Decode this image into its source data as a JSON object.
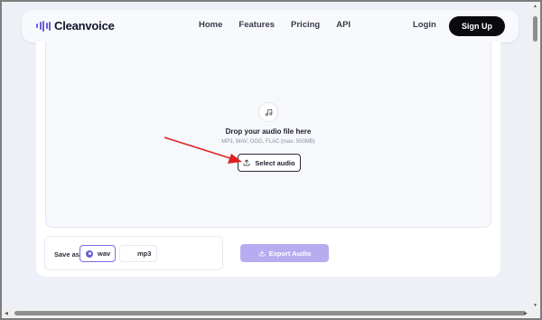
{
  "app": {
    "brand": "Cleanvoice",
    "accent_color": "#6b5fd6"
  },
  "nav": {
    "links": [
      "Home",
      "Features",
      "Pricing",
      "API"
    ],
    "login": "Login",
    "signup": "Sign Up"
  },
  "upload": {
    "icon": "music-note-icon",
    "title": "Drop your audio file here",
    "subtitle": "MP3, WAV, OGG, FLAC (max. 500MB)",
    "button": "Select audio",
    "button_icon": "upload-icon"
  },
  "export": {
    "save_as_label": "Save as",
    "formats": [
      {
        "label": "wav",
        "selected": true
      },
      {
        "label": "mp3",
        "selected": false
      }
    ],
    "button": "Export Audio",
    "button_icon": "download-icon"
  },
  "annotation": {
    "arrow_color": "#e02020"
  }
}
